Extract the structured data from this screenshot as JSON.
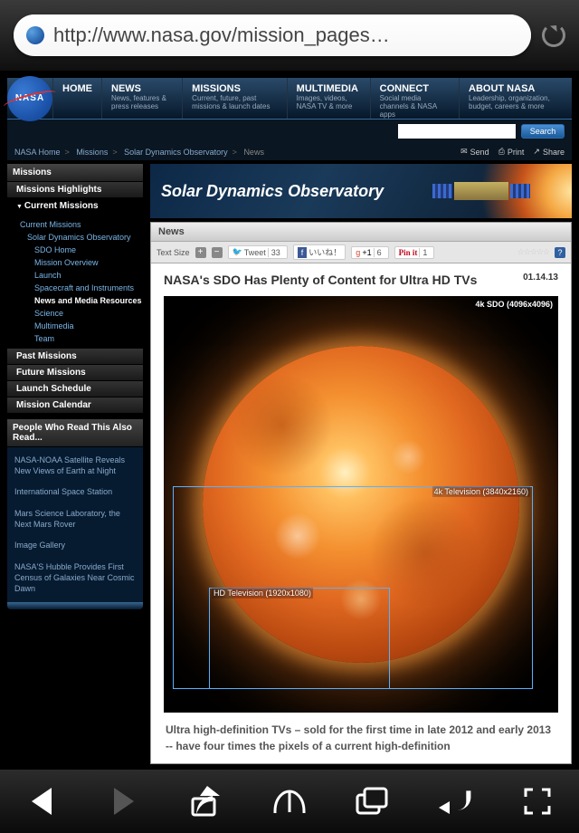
{
  "browser": {
    "url": "http://www.nasa.gov/mission_pages…"
  },
  "nav": {
    "items": [
      {
        "title": "HOME",
        "sub": ""
      },
      {
        "title": "NEWS",
        "sub": "News, features & press releases"
      },
      {
        "title": "MISSIONS",
        "sub": "Current, future, past missions & launch dates"
      },
      {
        "title": "MULTIMEDIA",
        "sub": "Images, videos, NASA TV & more"
      },
      {
        "title": "CONNECT",
        "sub": "Social media channels & NASA apps"
      },
      {
        "title": "ABOUT NASA",
        "sub": "Leadership, organization, budget, careers & more"
      }
    ],
    "search_btn": "Search"
  },
  "breadcrumb": {
    "items": [
      "NASA Home",
      "Missions",
      "Solar Dynamics Observatory",
      "News"
    ]
  },
  "page_actions": [
    "Send",
    "Print",
    "Share"
  ],
  "sidebar": {
    "header": "Missions",
    "highlights": "Missions Highlights",
    "current": "Current Missions",
    "tree": [
      {
        "label": "Current Missions",
        "lvl": 0
      },
      {
        "label": "Solar Dynamics Observatory",
        "lvl": 1
      },
      {
        "label": "SDO Home",
        "lvl": 2
      },
      {
        "label": "Mission Overview",
        "lvl": 2
      },
      {
        "label": "Launch",
        "lvl": 2
      },
      {
        "label": "Spacecraft and Instruments",
        "lvl": 2
      },
      {
        "label": "News and Media Resources",
        "lvl": 2,
        "current": true
      },
      {
        "label": "Science",
        "lvl": 2
      },
      {
        "label": "Multimedia",
        "lvl": 2
      },
      {
        "label": "Team",
        "lvl": 2
      }
    ],
    "past": "Past Missions",
    "future": "Future Missions",
    "schedule": "Launch Schedule",
    "calendar": "Mission Calendar",
    "related_header": "People Who Read This Also Read...",
    "related": [
      "NASA-NOAA Satellite Reveals New Views of Earth at Night",
      "International Space Station",
      "Mars Science Laboratory, the Next Mars Rover",
      "Image Gallery",
      "NASA'S Hubble Provides First Census of Galaxies Near Cosmic Dawn"
    ]
  },
  "hero": {
    "title": "Solar Dynamics Observatory"
  },
  "news": {
    "header": "News"
  },
  "toolbar": {
    "text_size": "Text Size",
    "tweet": "Tweet",
    "tweet_count": "33",
    "fb": "いいね！",
    "gplus": "+1",
    "gplus_count": "6",
    "pin": "Pin it",
    "pin_count": "1"
  },
  "article": {
    "title": "NASA's SDO Has Plenty of Content for Ultra HD TVs",
    "date": "01.14.13",
    "label_4k_sdo": "4k SDO (4096x4096)",
    "label_4k_tv": "4k Television (3840x2160)",
    "label_hd": "HD Television (1920x1080)",
    "caption": "Ultra high-definition TVs – sold for the first time in late 2012 and early 2013 -- have four times the pixels of a current high-definition"
  }
}
